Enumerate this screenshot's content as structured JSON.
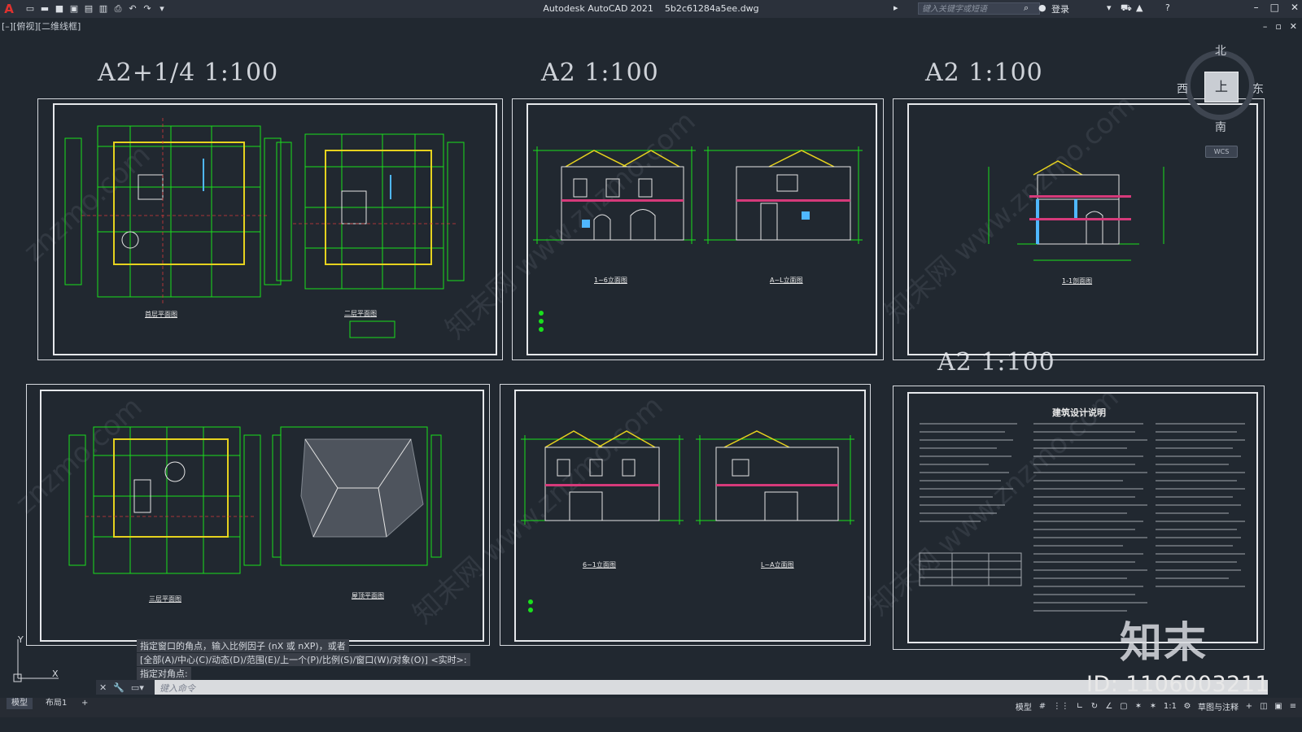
{
  "app": {
    "name": "Autodesk AutoCAD 2021",
    "file": "5b2c61284a5ee.dwg",
    "search_placeholder": "键入关键字或短语",
    "login": "登录",
    "viewport_label": "[–][俯视][二维线框]"
  },
  "sheets": [
    {
      "scale": "A2+1/4  1:100",
      "titles": [
        "首层平面图",
        "二层平面图"
      ]
    },
    {
      "scale": "A2  1:100",
      "titles": [
        "1~6立面图",
        "A~L立面图"
      ]
    },
    {
      "scale": "A2  1:100",
      "titles": [
        "1-1剖面图"
      ]
    },
    {
      "scale": "A2  1:100",
      "titles": [
        "建筑设计说明"
      ]
    },
    {
      "titles": [
        "三层平面图",
        "屋顶平面图"
      ]
    },
    {
      "titles": [
        "6~1立面图",
        "L~A立面图"
      ]
    }
  ],
  "viewcube": {
    "north": "北",
    "south": "南",
    "west": "西",
    "east": "东",
    "face": "上",
    "wcs": "WCS"
  },
  "command": {
    "history": [
      "指定窗口的角点，输入比例因子 (nX 或 nXP)，或者",
      "[全部(A)/中心(C)/动态(D)/范围(E)/上一个(P)/比例(S)/窗口(W)/对象(O)] <实时>:",
      "指定对角点:"
    ],
    "placeholder": "键入命令"
  },
  "status": {
    "tabs": [
      "模型",
      "布局1",
      "+"
    ],
    "model": "模型",
    "scale": "1:1",
    "workspace": "草图与注释"
  },
  "watermark": {
    "logo": "知末",
    "id": "ID: 1106003211"
  }
}
